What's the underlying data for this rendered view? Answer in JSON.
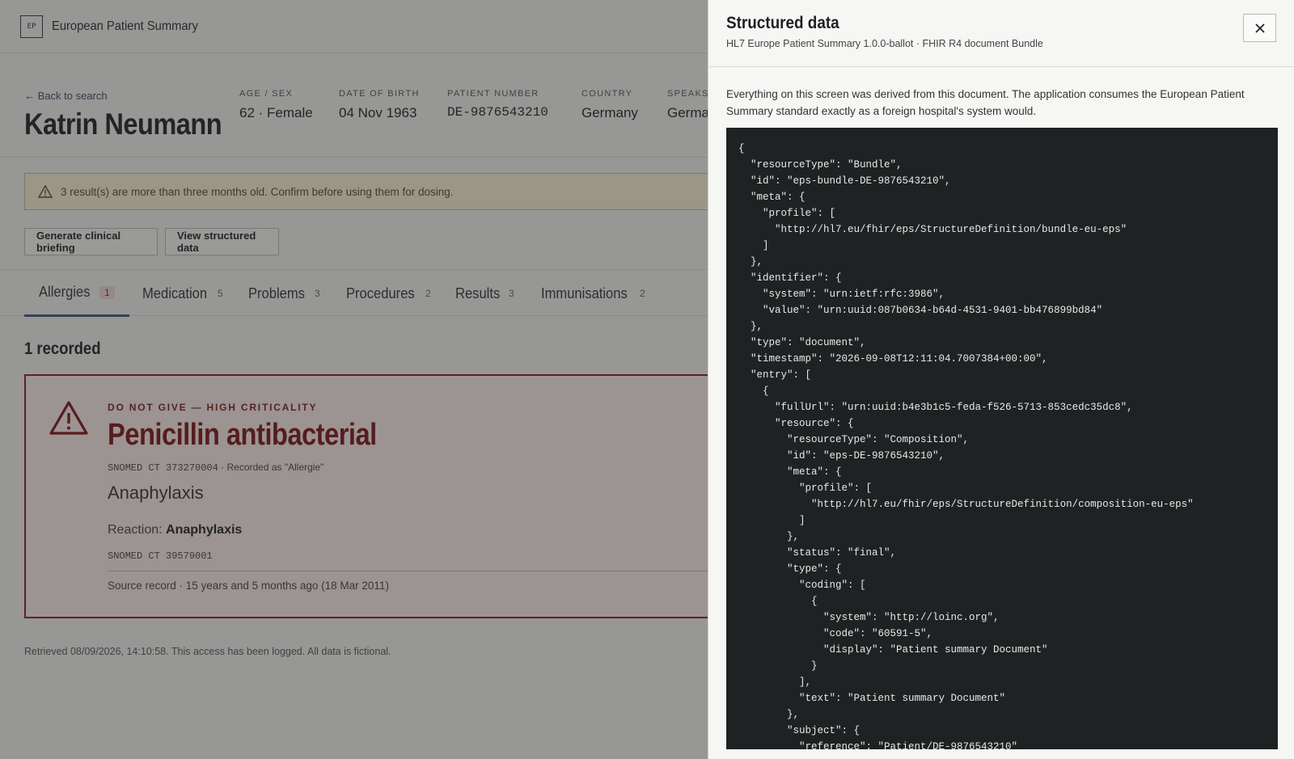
{
  "app": {
    "logo": "EP",
    "title": "European Patient Summary"
  },
  "patient": {
    "back_link": "← Back to search",
    "name": "Katrin Neumann",
    "meta": [
      {
        "label": "AGE / SEX",
        "value": "62 · Female"
      },
      {
        "label": "DATE OF BIRTH",
        "value": "04 Nov 1963"
      },
      {
        "label": "PATIENT NUMBER",
        "value": "DE-9876543210"
      },
      {
        "label": "COUNTRY",
        "value": "Germany"
      },
      {
        "label": "SPEAKS",
        "value": "German"
      }
    ]
  },
  "warning": {
    "icon": "warning-triangle-icon",
    "text": "3 result(s) are more than three months old. Confirm before using them for dosing."
  },
  "actions": {
    "briefing": "Generate clinical briefing",
    "structured": "View structured data"
  },
  "tabs": [
    {
      "label": "Allergies",
      "count": "1"
    },
    {
      "label": "Medication",
      "count": "5"
    },
    {
      "label": "Problems",
      "count": "3"
    },
    {
      "label": "Procedures",
      "count": "2"
    },
    {
      "label": "Results",
      "count": "3"
    },
    {
      "label": "Immunisations",
      "count": "2"
    }
  ],
  "allergies": {
    "recorded": "1 recorded",
    "card": {
      "criticality": "DO NOT GIVE — HIGH CRITICALITY",
      "name": "Penicillin antibacterial",
      "code_mono": "SNOMED CT 373270004",
      "code_note": " · Recorded as \"Allergie\"",
      "manifestation": "Anaphylaxis",
      "reaction_label": "Reaction: ",
      "reaction_value": "Anaphylaxis",
      "reaction_code": "SNOMED CT 39579001",
      "source": "Source record · 15 years and 5 months ago (18 Mar 2011)"
    }
  },
  "footer": "Retrieved 08/09/2026, 14:10:58. This access has been logged. All data is fictional.",
  "drawer": {
    "title": "Structured data",
    "subtitle": "HL7 Europe Patient Summary 1.0.0-ballot · FHIR R4 document Bundle",
    "close_icon": "close-icon",
    "intro": "Everything on this screen was derived from this document. The application consumes the European Patient Summary standard exactly as a foreign hospital's system would.",
    "json_lines": [
      "{",
      "  \"resourceType\": \"Bundle\",",
      "  \"id\": \"eps-bundle-DE-9876543210\",",
      "  \"meta\": {",
      "    \"profile\": [",
      "      \"http://hl7.eu/fhir/eps/StructureDefinition/bundle-eu-eps\"",
      "    ]",
      "  },",
      "  \"identifier\": {",
      "    \"system\": \"urn:ietf:rfc:3986\",",
      "    \"value\": \"urn:uuid:087b0634-b64d-4531-9401-bb476899bd84\"",
      "  },",
      "  \"type\": \"document\",",
      "  \"timestamp\": \"2026-09-08T12:11:04.7007384+00:00\",",
      "  \"entry\": [",
      "    {",
      "      \"fullUrl\": \"urn:uuid:b4e3b1c5-feda-f526-5713-853cedc35dc8\",",
      "      \"resource\": {",
      "        \"resourceType\": \"Composition\",",
      "        \"id\": \"eps-DE-9876543210\",",
      "        \"meta\": {",
      "          \"profile\": [",
      "            \"http://hl7.eu/fhir/eps/StructureDefinition/composition-eu-eps\"",
      "          ]",
      "        },",
      "        \"status\": \"final\",",
      "        \"type\": {",
      "          \"coding\": [",
      "            {",
      "              \"system\": \"http://loinc.org\",",
      "              \"code\": \"60591-5\",",
      "              \"display\": \"Patient summary Document\"",
      "            }",
      "          ],",
      "          \"text\": \"Patient summary Document\"",
      "        },",
      "        \"subject\": {",
      "          \"reference\": \"Patient/DE-9876543210\""
    ]
  }
}
